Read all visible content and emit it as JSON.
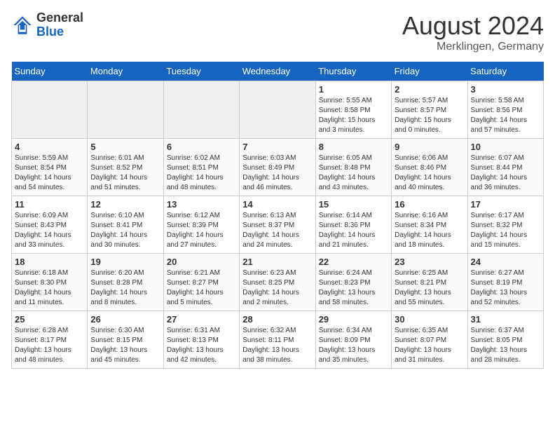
{
  "header": {
    "logo_general": "General",
    "logo_blue": "Blue",
    "month_year": "August 2024",
    "location": "Merklingen, Germany"
  },
  "days_of_week": [
    "Sunday",
    "Monday",
    "Tuesday",
    "Wednesday",
    "Thursday",
    "Friday",
    "Saturday"
  ],
  "weeks": [
    [
      {
        "day": "",
        "empty": true
      },
      {
        "day": "",
        "empty": true
      },
      {
        "day": "",
        "empty": true
      },
      {
        "day": "",
        "empty": true
      },
      {
        "day": "1",
        "sunrise": "5:55 AM",
        "sunset": "8:58 PM",
        "daylight": "15 hours and 3 minutes."
      },
      {
        "day": "2",
        "sunrise": "5:57 AM",
        "sunset": "8:57 PM",
        "daylight": "15 hours and 0 minutes."
      },
      {
        "day": "3",
        "sunrise": "5:58 AM",
        "sunset": "8:56 PM",
        "daylight": "14 hours and 57 minutes."
      }
    ],
    [
      {
        "day": "4",
        "sunrise": "5:59 AM",
        "sunset": "8:54 PM",
        "daylight": "14 hours and 54 minutes."
      },
      {
        "day": "5",
        "sunrise": "6:01 AM",
        "sunset": "8:52 PM",
        "daylight": "14 hours and 51 minutes."
      },
      {
        "day": "6",
        "sunrise": "6:02 AM",
        "sunset": "8:51 PM",
        "daylight": "14 hours and 48 minutes."
      },
      {
        "day": "7",
        "sunrise": "6:03 AM",
        "sunset": "8:49 PM",
        "daylight": "14 hours and 46 minutes."
      },
      {
        "day": "8",
        "sunrise": "6:05 AM",
        "sunset": "8:48 PM",
        "daylight": "14 hours and 43 minutes."
      },
      {
        "day": "9",
        "sunrise": "6:06 AM",
        "sunset": "8:46 PM",
        "daylight": "14 hours and 40 minutes."
      },
      {
        "day": "10",
        "sunrise": "6:07 AM",
        "sunset": "8:44 PM",
        "daylight": "14 hours and 36 minutes."
      }
    ],
    [
      {
        "day": "11",
        "sunrise": "6:09 AM",
        "sunset": "8:43 PM",
        "daylight": "14 hours and 33 minutes."
      },
      {
        "day": "12",
        "sunrise": "6:10 AM",
        "sunset": "8:41 PM",
        "daylight": "14 hours and 30 minutes."
      },
      {
        "day": "13",
        "sunrise": "6:12 AM",
        "sunset": "8:39 PM",
        "daylight": "14 hours and 27 minutes."
      },
      {
        "day": "14",
        "sunrise": "6:13 AM",
        "sunset": "8:37 PM",
        "daylight": "14 hours and 24 minutes."
      },
      {
        "day": "15",
        "sunrise": "6:14 AM",
        "sunset": "8:36 PM",
        "daylight": "14 hours and 21 minutes."
      },
      {
        "day": "16",
        "sunrise": "6:16 AM",
        "sunset": "8:34 PM",
        "daylight": "14 hours and 18 minutes."
      },
      {
        "day": "17",
        "sunrise": "6:17 AM",
        "sunset": "8:32 PM",
        "daylight": "14 hours and 15 minutes."
      }
    ],
    [
      {
        "day": "18",
        "sunrise": "6:18 AM",
        "sunset": "8:30 PM",
        "daylight": "14 hours and 11 minutes."
      },
      {
        "day": "19",
        "sunrise": "6:20 AM",
        "sunset": "8:28 PM",
        "daylight": "14 hours and 8 minutes."
      },
      {
        "day": "20",
        "sunrise": "6:21 AM",
        "sunset": "8:27 PM",
        "daylight": "14 hours and 5 minutes."
      },
      {
        "day": "21",
        "sunrise": "6:23 AM",
        "sunset": "8:25 PM",
        "daylight": "14 hours and 2 minutes."
      },
      {
        "day": "22",
        "sunrise": "6:24 AM",
        "sunset": "8:23 PM",
        "daylight": "13 hours and 58 minutes."
      },
      {
        "day": "23",
        "sunrise": "6:25 AM",
        "sunset": "8:21 PM",
        "daylight": "13 hours and 55 minutes."
      },
      {
        "day": "24",
        "sunrise": "6:27 AM",
        "sunset": "8:19 PM",
        "daylight": "13 hours and 52 minutes."
      }
    ],
    [
      {
        "day": "25",
        "sunrise": "6:28 AM",
        "sunset": "8:17 PM",
        "daylight": "13 hours and 48 minutes."
      },
      {
        "day": "26",
        "sunrise": "6:30 AM",
        "sunset": "8:15 PM",
        "daylight": "13 hours and 45 minutes."
      },
      {
        "day": "27",
        "sunrise": "6:31 AM",
        "sunset": "8:13 PM",
        "daylight": "13 hours and 42 minutes."
      },
      {
        "day": "28",
        "sunrise": "6:32 AM",
        "sunset": "8:11 PM",
        "daylight": "13 hours and 38 minutes."
      },
      {
        "day": "29",
        "sunrise": "6:34 AM",
        "sunset": "8:09 PM",
        "daylight": "13 hours and 35 minutes."
      },
      {
        "day": "30",
        "sunrise": "6:35 AM",
        "sunset": "8:07 PM",
        "daylight": "13 hours and 31 minutes."
      },
      {
        "day": "31",
        "sunrise": "6:37 AM",
        "sunset": "8:05 PM",
        "daylight": "13 hours and 28 minutes."
      }
    ]
  ]
}
